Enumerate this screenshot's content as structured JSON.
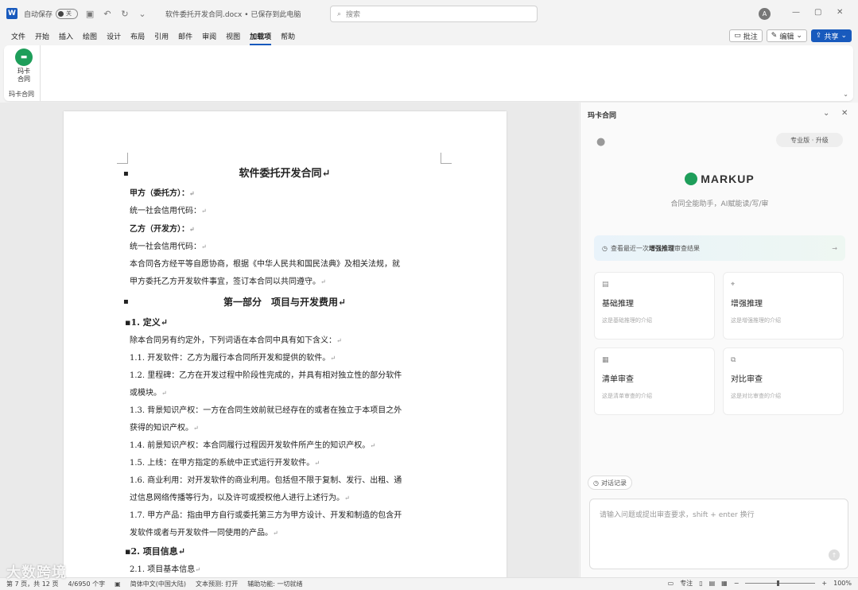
{
  "titlebar": {
    "app_icon": "W",
    "autosave_label": "自动保存",
    "autosave_state": "关",
    "doc_title": "软件委托开发合同.docx • 已保存到此电脑",
    "search_placeholder": "搜索",
    "user_initial": "A"
  },
  "menu": {
    "items": [
      "文件",
      "开始",
      "插入",
      "绘图",
      "设计",
      "布局",
      "引用",
      "邮件",
      "审阅",
      "视图",
      "加载项",
      "帮助"
    ],
    "active": "加载项",
    "comment_label": "批注",
    "edit_label": "编辑",
    "share_label": "共享"
  },
  "ribbon": {
    "button_label_line1": "玛卡",
    "button_label_line2": "合同",
    "group_name": "玛卡合同"
  },
  "document": {
    "title": "软件委托开发合同",
    "party_a_label": "甲方（委托方）：",
    "credit_code_1": "统一社会信用代码：",
    "party_b_label": "乙方（开发方）：",
    "credit_code_2": "统一社会信用代码：",
    "intro_1": "本合同各方经平等自愿协商，根据《中华人民共和国民法典》及相关法规，就",
    "intro_2": "甲方委托乙方开发软件事宜，签订本合同以共同遵守。",
    "part1_title": "第一部分　项目与开发费用",
    "section1_title": "1. 定义",
    "def_intro": "除本合同另有约定外，下列词语在本合同中具有如下含义：",
    "def_1_1": "1.1. 开发软件：乙方为履行本合同所开发和提供的软件。",
    "def_1_2a": "1.2. 里程碑：乙方在开发过程中阶段性完成的，并具有相对独立性的部分软件",
    "def_1_2b": "或模块。",
    "def_1_3a": "1.3. 背景知识产权：一方在合同生效前就已经存在的或者在独立于本项目之外",
    "def_1_3b": "获得的知识产权。",
    "def_1_4": "1.4. 前景知识产权：本合同履行过程因开发软件所产生的知识产权。",
    "def_1_5": "1.5. 上线：在甲方指定的系统中正式运行开发软件。",
    "def_1_6a": "1.6. 商业利用：对开发软件的商业利用。包括但不限于复制、发行、出租、通",
    "def_1_6b": "过信息网络传播等行为，以及许可或授权他人进行上述行为。",
    "def_1_7a": "1.7. 甲方产品：指由甲方自行或委托第三方为甲方设计、开发和制造的包含开",
    "def_1_7b": "发软件或者与开发软件一同使用的产品。",
    "section2_title": "2. 项目信息",
    "info_2_1": "2.1. 项目基本信息"
  },
  "sidepane": {
    "title": "玛卡合同",
    "upgrade_label": "专业版 · 升级",
    "brand_name": "MARKUP",
    "brand_tagline": "合同全能助手，AI赋能读/写/审",
    "recent_prefix": "查看最近一次",
    "recent_highlight": "增强推理",
    "recent_suffix": "审查结果",
    "cards": [
      {
        "icon": "basic-reasoning-icon",
        "title": "基础推理",
        "desc": "这是基础推理的介绍"
      },
      {
        "icon": "enhanced-reasoning-icon",
        "title": "增强推理",
        "desc": "这是增强推理的介绍"
      },
      {
        "icon": "checklist-review-icon",
        "title": "清单审查",
        "desc": "这是清单审查的介绍"
      },
      {
        "icon": "compare-review-icon",
        "title": "对比审查",
        "desc": "这是对比审查的介绍"
      }
    ],
    "history_label": "对话记录",
    "input_placeholder": "请输入问题或提出审查要求，shift + enter 换行"
  },
  "statusbar": {
    "page": "第 7 页，共 12 页",
    "words": "4/6950 个字",
    "lang": "简体中文(中国大陆)",
    "prediction": "文本预测: 打开",
    "accessibility": "辅助功能: 一切就绪",
    "focus": "专注",
    "zoom": "100%"
  },
  "watermark": "大数跨境",
  "colors": {
    "accent": "#185abd",
    "brand_green": "#1e9e5a"
  }
}
